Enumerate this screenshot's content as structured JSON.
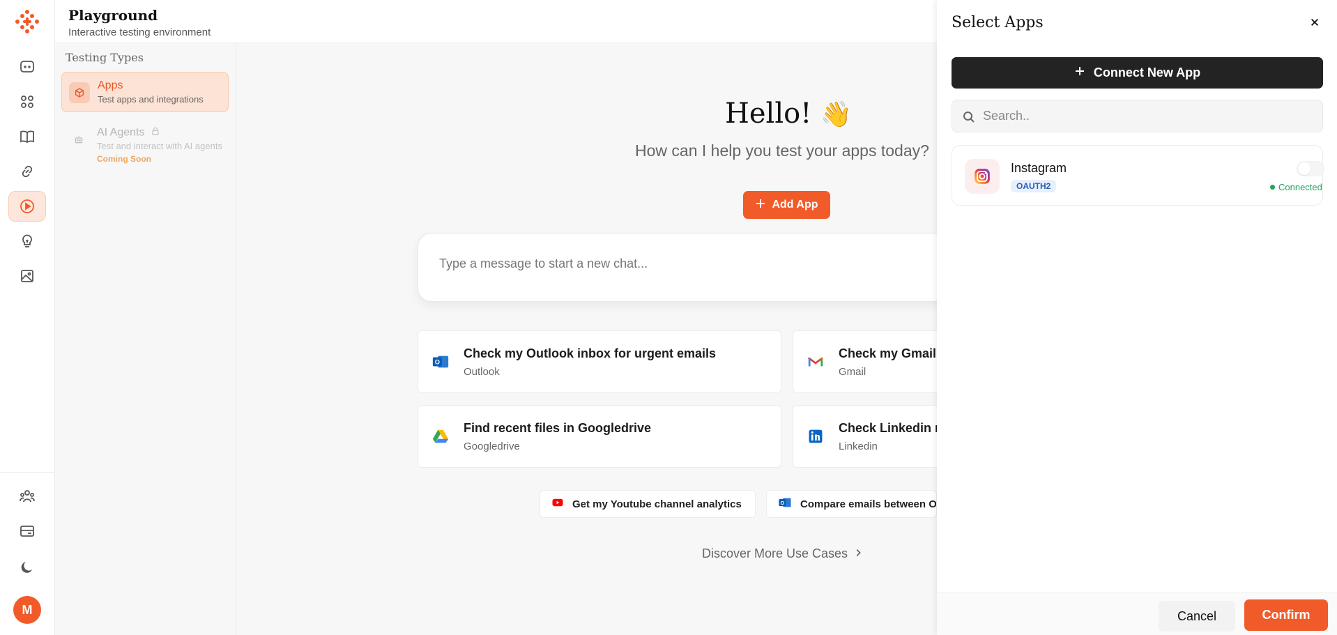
{
  "header": {
    "title": "Playground",
    "subtitle": "Interactive testing environment"
  },
  "rail": {
    "items": [
      "chat-icon",
      "grid-icon",
      "book-icon",
      "link-icon",
      "play-icon",
      "bulb-icon",
      "image-icon"
    ],
    "active": "play-icon",
    "bottom": [
      "users-icon",
      "billing-icon",
      "moon-icon"
    ],
    "avatar_initial": "M",
    "accent": "#f15a29"
  },
  "testing_types": {
    "heading": "Testing Types",
    "items": [
      {
        "title": "Apps",
        "desc": "Test apps and integrations",
        "active": true
      },
      {
        "title": "AI Agents",
        "desc": "Test and interact with AI agents",
        "badge": "Coming Soon",
        "locked": true
      }
    ]
  },
  "main": {
    "greeting": "Hello!",
    "wave": "👋",
    "subheading": "How can I help you test your apps today?",
    "add_app_label": "Add App",
    "chat_placeholder": "Type a message to start a new chat...",
    "suggestions": [
      {
        "title": "Check my Outlook inbox for urgent emails",
        "app": "Outlook"
      },
      {
        "title": "Check my Gmail",
        "app": "Gmail"
      },
      {
        "title": "Find recent files in Googledrive",
        "app": "Googledrive"
      },
      {
        "title": "Check Linkedin r",
        "app": "Linkedin"
      }
    ],
    "chips": [
      {
        "label": "Get my Youtube channel analytics"
      },
      {
        "label": "Compare emails between O"
      }
    ],
    "discover_label": "Discover More Use Cases"
  },
  "drawer": {
    "title": "Select Apps",
    "connect_label": "Connect New App",
    "search_placeholder": "Search..",
    "apps": [
      {
        "name": "Instagram",
        "auth": "OAUTH2",
        "status": "Connected"
      }
    ],
    "cancel_label": "Cancel",
    "confirm_label": "Confirm"
  }
}
